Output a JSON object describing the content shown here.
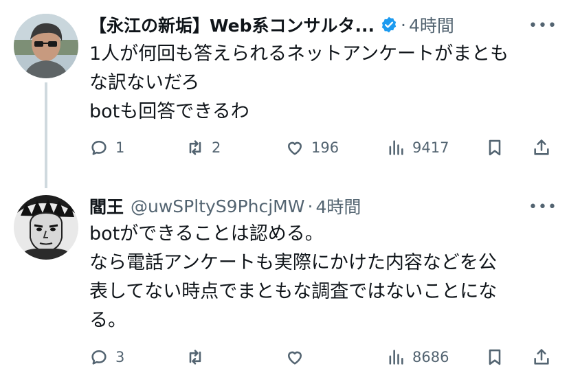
{
  "tweets": [
    {
      "name": "【永江の新垢】Web系コンサルタ...",
      "handle": "",
      "dot": "·",
      "time": "4時間",
      "lines": [
        "1人が何回も答えられるネットアンケートがまとも",
        "な訳ないだろ",
        "botも回答できるわ"
      ],
      "replies": "1",
      "retweets": "2",
      "likes": "196",
      "views": "9417"
    },
    {
      "name": "閻王",
      "handle": "@uwSPltyS9PhcjMW",
      "dot": "·",
      "time": "4時間",
      "lines": [
        "botができることは認める。",
        "なら電話アンケートも実際にかけた内容などを公",
        "表してない時点でまともな調査ではないことにな",
        "る。"
      ],
      "replies": "3",
      "retweets": "",
      "likes": "",
      "views": "8686"
    }
  ],
  "colors": {
    "text": "#0f1419",
    "secondary": "#536471",
    "verified": "#1d9bf0",
    "thread_line": "#cfd9de"
  },
  "icons": [
    "reply-icon",
    "retweet-icon",
    "like-icon",
    "views-icon",
    "bookmark-icon",
    "share-icon",
    "verified-badge-icon",
    "more-icon"
  ]
}
